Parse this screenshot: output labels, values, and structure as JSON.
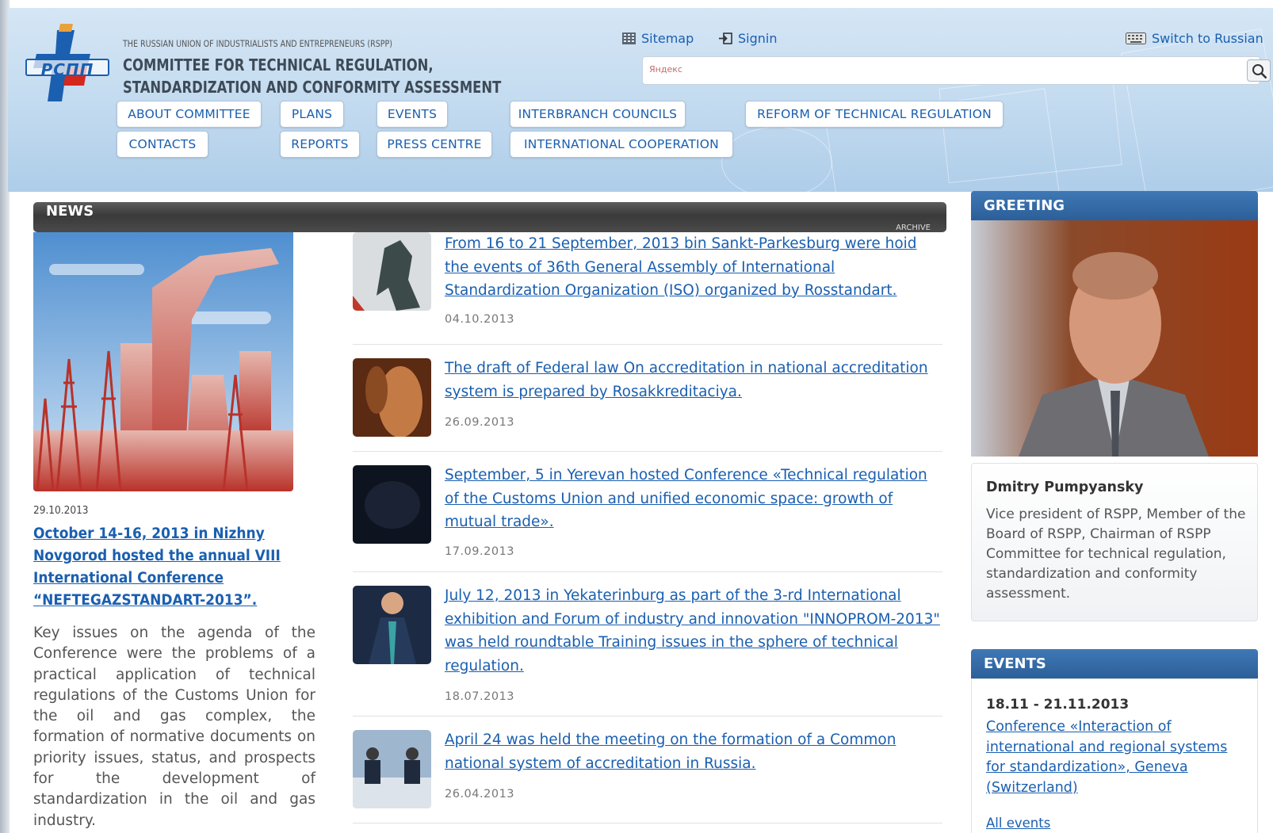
{
  "header": {
    "org_name": "THE RUSSIAN UNION OF INDUSTRIALISTS AND ENTREPRENEURS (RSPP)",
    "committee_line1": "COMMITTEE FOR TECHNICAL REGULATION,",
    "committee_line2": "STANDARDIZATION AND CONFORMITY ASSESSMENT",
    "logo_text": "РСПП",
    "sitemap_label": "Sitemap",
    "signin_label": "Signin",
    "switch_label": "Switch to Russian",
    "search_placeholder": "Яндекс"
  },
  "nav": {
    "about": "ABOUT COMMITTEE",
    "plans": "PLANS",
    "events": "EVENTS",
    "councils": "INTERBRANCH COUNCILS",
    "reform": "REFORM OF TECHNICAL REGULATION",
    "contacts": "CONTACTS",
    "reports": "REPORTS",
    "press": "PRESS CENTRE",
    "cooperation": "INTERNATIONAL COOPERATION"
  },
  "news": {
    "heading": "NEWS",
    "archive_label": "ARCHIVE",
    "featured": {
      "date": "29.10.2013",
      "title": "October 14-16, 2013 in Nizhny Novgorod hosted the annual VIII International Conference “NEFTEGAZSTANDART-2013”.",
      "text": "Key issues on the agenda of the Conference were the problems of a practical application of technical regulations of the Customs Union for the oil and gas complex, the formation of normative documents on priority issues, status, and prospects for the development of standardization in the oil and gas industry."
    },
    "items": [
      {
        "title": "From 16 to 21 September, 2013 bin Sankt-Parkesburg were hoid the events of 36th General Assembly of International Standardization Organization (ISO) organized by Rosstandart.",
        "date": "04.10.2013"
      },
      {
        "title": "The draft of Federal law On accreditation in national accreditation system is prepared by Rosakkreditaciya.",
        "date": "26.09.2013"
      },
      {
        "title": "September, 5 in Yerevan hosted Conference «Technical regulation of the Customs Union and unified economic space: growth of mutual trade».",
        "date": "17.09.2013"
      },
      {
        "title": "July 12, 2013 in Yekaterinburg as part of the 3-rd International exhibition and Forum of industry and innovation \"INNOPROM-2013\" was held roundtable Training issues in the sphere of technical regulation.",
        "date": "18.07.2013"
      },
      {
        "title": "April 24 was held the meeting on the formation of a Common national system of accreditation in Russia.",
        "date": "26.04.2013"
      }
    ]
  },
  "greeting": {
    "heading": "GREETING",
    "name": "Dmitry Pumpyansky",
    "description": "Vice president of RSPP, Member of the Board of RSPP, Chairman of RSPP Committee for technical regulation, standardization and conformity assessment."
  },
  "events": {
    "heading": "EVENTS",
    "date": "18.11 - 21.11.2013",
    "title": "Conference «Interaction of international and regional systems for standardization», Geneva (Switzerland)",
    "all_label": "All events"
  },
  "colors": {
    "link": "#1a5fb0",
    "header_bg": "#c2daef",
    "news_bar": "#3a3a3a",
    "side_header": "#2c5f98",
    "feature_red": "#c0392b"
  },
  "icons": [
    "sitemap-icon",
    "signin-icon",
    "keyboard-icon",
    "search-icon",
    "logo-icon"
  ]
}
